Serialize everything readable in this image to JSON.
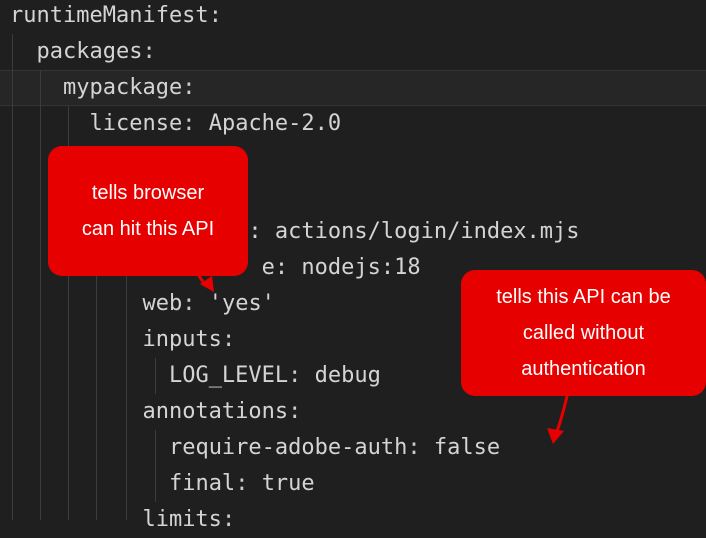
{
  "code_lines": [
    {
      "indent": "",
      "key": "runtimeManifest",
      "sep": ":",
      "value": ""
    },
    {
      "indent": "  ",
      "key": "packages",
      "sep": ":",
      "value": ""
    },
    {
      "indent": "    ",
      "key": "mypackage",
      "sep": ":",
      "value": ""
    },
    {
      "indent": "      ",
      "key": "license",
      "sep": ": ",
      "value": "Apache-2.0"
    },
    {
      "indent": "",
      "key": "",
      "sep": "",
      "value": ""
    },
    {
      "indent": "",
      "key": "",
      "sep": "",
      "value": ""
    },
    {
      "indent": "                ",
      "key": "",
      "sep": "",
      "value": "on: actions/login/index.mjs"
    },
    {
      "indent": "                   ",
      "key": "",
      "sep": "",
      "value": "e: nodejs:18"
    },
    {
      "indent": "          ",
      "key": "web",
      "sep": ": ",
      "value": "'yes'"
    },
    {
      "indent": "          ",
      "key": "inputs",
      "sep": ":",
      "value": ""
    },
    {
      "indent": "            ",
      "key": "LOG_LEVEL",
      "sep": ": ",
      "value": "debug"
    },
    {
      "indent": "          ",
      "key": "annotations",
      "sep": ":",
      "value": ""
    },
    {
      "indent": "            ",
      "key": "require-adobe-auth",
      "sep": ": ",
      "value": "false"
    },
    {
      "indent": "            ",
      "key": "final",
      "sep": ": ",
      "value": "true"
    },
    {
      "indent": "          ",
      "key": "limits",
      "sep": ":",
      "value": ""
    }
  ],
  "callouts": {
    "browser": {
      "line1": "tells browser",
      "line2": "can hit this API"
    },
    "auth": {
      "line1": "tells this API can be",
      "line2": "called without",
      "line3": "authentication"
    }
  },
  "colors": {
    "background": "#1f1f1f",
    "callout": "#e60000",
    "text": "#d4d4d4"
  }
}
